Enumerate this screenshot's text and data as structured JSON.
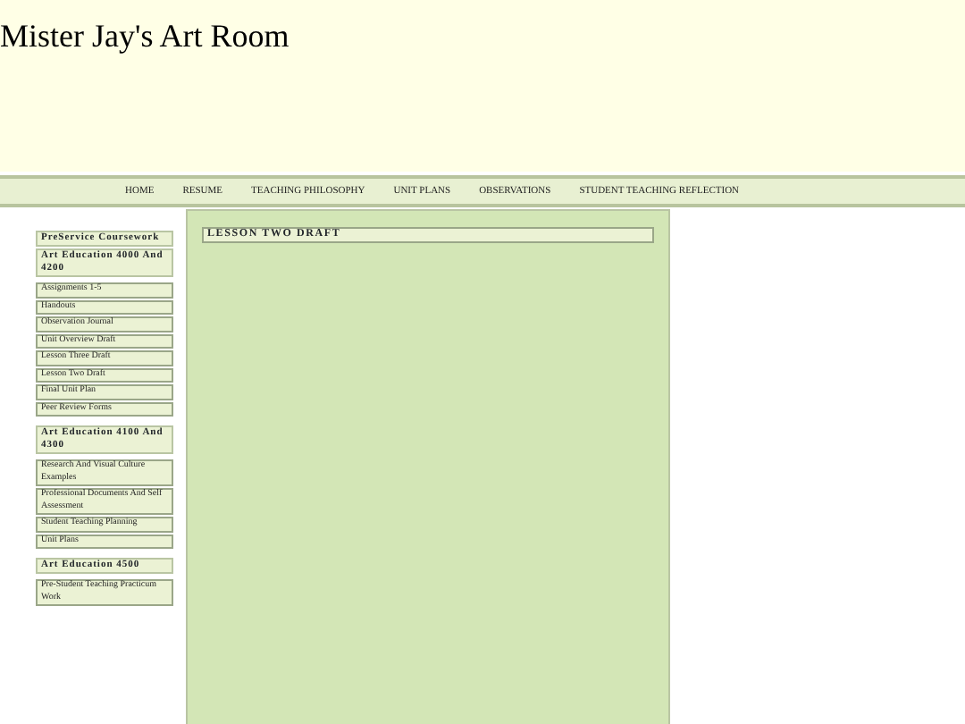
{
  "site_title": "Mister Jay's Art Room",
  "nav": [
    "HOME",
    "RESUME",
    "TEACHING PHILOSOPHY",
    "UNIT PLANS",
    "OBSERVATIONS",
    "STUDENT TEACHING REFLECTION"
  ],
  "sidebar": [
    {
      "headings": [
        "PreService Coursework",
        "Art Education 4000 And 4200"
      ],
      "links": [
        "Assignments 1-5",
        "Handouts",
        "Observation Journal",
        "Unit Overview Draft",
        "Lesson Three Draft",
        "Lesson Two Draft",
        "Final Unit Plan",
        "Peer Review Forms"
      ]
    },
    {
      "headings": [
        "Art Education 4100 And 4300"
      ],
      "links": [
        "Research And Visual Culture Examples",
        "Professional Documents And Self Assessment",
        "Student Teaching Planning",
        "Unit Plans"
      ]
    },
    {
      "headings": [
        "Art Education 4500"
      ],
      "links": [
        "Pre-Student Teaching Practicum Work"
      ]
    }
  ],
  "page_title": "LESSON TWO DRAFT"
}
